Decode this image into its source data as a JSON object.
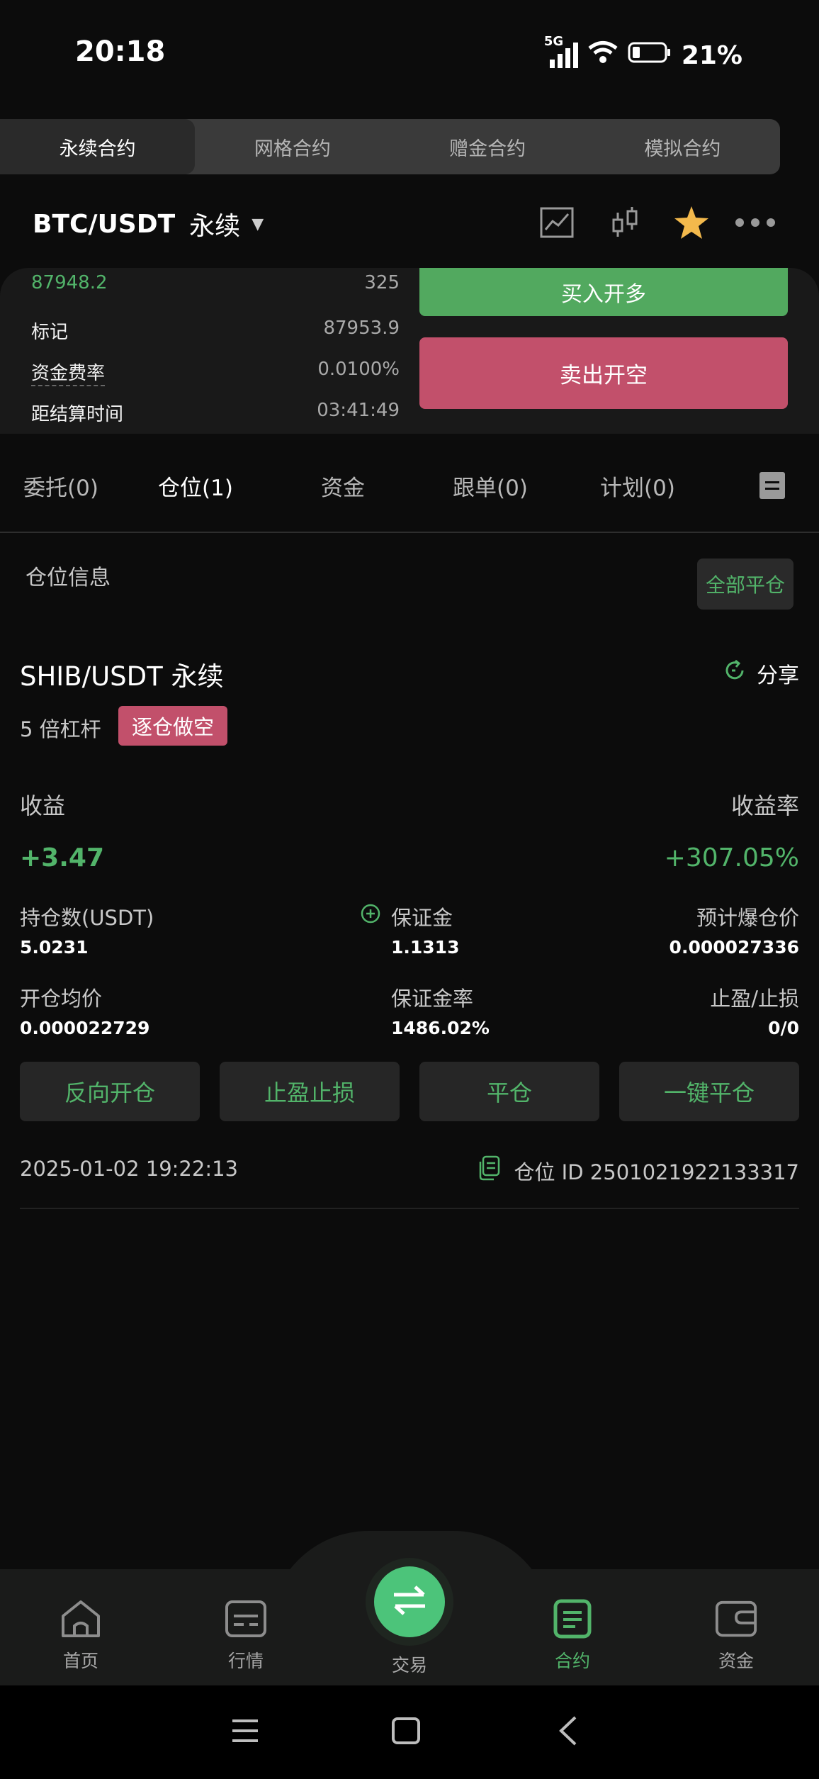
{
  "status_bar": {
    "time": "20:18",
    "network": "5G",
    "battery": "21%"
  },
  "contract_tabs": [
    {
      "label": "永续合约",
      "active": true
    },
    {
      "label": "网格合约",
      "active": false
    },
    {
      "label": "赠金合约",
      "active": false
    },
    {
      "label": "模拟合约",
      "active": false
    }
  ],
  "symbol": {
    "name": "BTC/USDT",
    "type": "永续"
  },
  "orderbook": {
    "last_price": "87948.2",
    "last_qty": "325",
    "mark_label": "标记",
    "mark_value": "87953.9",
    "funding_label": "资金费率",
    "funding_value": "0.0100%",
    "settle_label": "距结算时间",
    "settle_value": "03:41:49"
  },
  "trade": {
    "buy_label": "买入开多",
    "sell_label": "卖出开空"
  },
  "sub_tabs": [
    {
      "label": "委托(0)",
      "active": false
    },
    {
      "label": "仓位(1)",
      "active": true
    },
    {
      "label": "资金",
      "active": false
    },
    {
      "label": "跟单(0)",
      "active": false
    },
    {
      "label": "计划(0)",
      "active": false
    }
  ],
  "position": {
    "section_title": "仓位信息",
    "close_all_label": "全部平仓",
    "symbol": "SHIB/USDT 永续",
    "share_label": "分享",
    "leverage": "5 倍杠杆",
    "side": "逐仓做空",
    "pnl_label": "收益",
    "pnl_value": "+3.47",
    "roe_label": "收益率",
    "roe_value": "+307.05%",
    "size_label": "持仓数(USDT)",
    "size_value": "5.0231",
    "margin_label": "保证金",
    "margin_value": "1.1313",
    "liq_label": "预计爆仓价",
    "liq_value": "0.000027336",
    "entry_label": "开仓均价",
    "entry_value": "0.000022729",
    "margin_ratio_label": "保证金率",
    "margin_ratio_value": "1486.02%",
    "tpsl_label": "止盈/止损",
    "tpsl_value": "0/0",
    "actions": [
      "反向开仓",
      "止盈止损",
      "平仓",
      "一键平仓"
    ],
    "open_time": "2025-01-02 19:22:13",
    "position_id": "仓位 ID 2501021922133317"
  },
  "bottom_nav": [
    {
      "label": "首页",
      "icon": "home-icon",
      "active": false
    },
    {
      "label": "行情",
      "icon": "market-icon",
      "active": false
    },
    {
      "label": "交易",
      "icon": "swap-icon",
      "active": false
    },
    {
      "label": "合约",
      "icon": "contract-icon",
      "active": true
    },
    {
      "label": "资金",
      "icon": "wallet-icon",
      "active": false
    }
  ],
  "colors": {
    "accent_green": "#52b46a",
    "short_red": "#c2506b",
    "buy_green": "#52a95f",
    "background": "#0c0c0c"
  }
}
